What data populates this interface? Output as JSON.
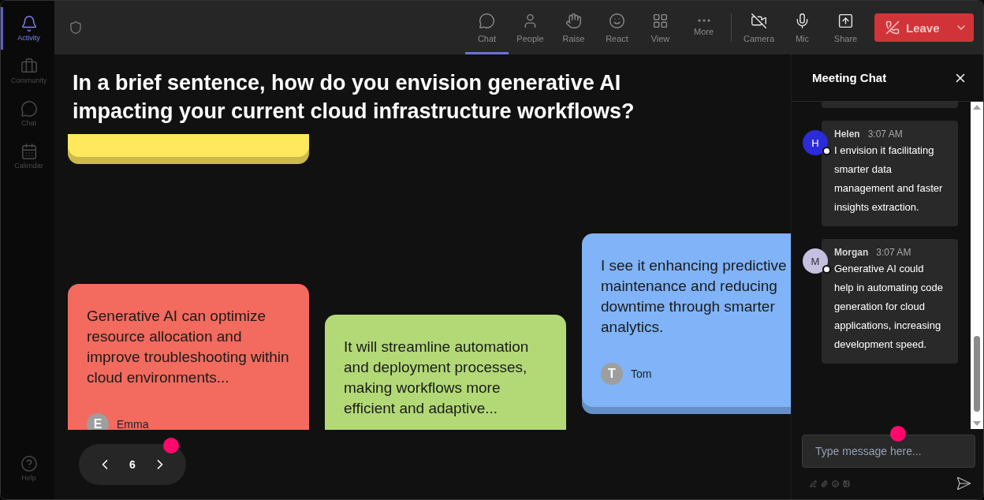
{
  "sidebar": {
    "items": [
      {
        "label": "Activity",
        "selected": true
      },
      {
        "label": "Community",
        "selected": false
      },
      {
        "label": "Chat",
        "selected": false
      },
      {
        "label": "Calendar",
        "selected": false
      }
    ],
    "footer_item": {
      "label": "Help"
    }
  },
  "toolbar": {
    "items": [
      {
        "label": "Chat",
        "selected": true
      },
      {
        "label": "People",
        "selected": false
      },
      {
        "label": "Raise",
        "selected": false
      },
      {
        "label": "React",
        "selected": false
      },
      {
        "label": "View",
        "selected": false
      },
      {
        "label": "More",
        "selected": false
      }
    ],
    "devices": [
      {
        "label": "Camera"
      },
      {
        "label": "Mic"
      },
      {
        "label": "Share"
      }
    ],
    "leave_button": "Leave"
  },
  "question": "In a brief sentence, how do you envision generative AI impacting your current cloud infrastructure workflows?",
  "cards": [
    {
      "kind": "clipped",
      "color": "#ffe85c"
    },
    {
      "kind": "note",
      "color": "#f26b5e",
      "text": "Generative AI can optimize resource allocation and improve troubleshooting within cloud environments...",
      "author": "Emma",
      "initial": "E"
    },
    {
      "kind": "note",
      "color": "#b3d977",
      "text": "It will streamline automation and deployment processes, making workflows more efficient and adaptive..."
    },
    {
      "kind": "note",
      "color": "#80b3f7",
      "text": "I see it enhancing predictive maintenance and reducing downtime through smarter analytics.",
      "author": "Tom",
      "initial": "T"
    }
  ],
  "pager": {
    "page": "6"
  },
  "chat": {
    "title": "Meeting Chat",
    "messages": [
      {
        "kind": "clipped"
      },
      {
        "kind": "message",
        "author": "Helen",
        "initial": "H",
        "color": "#2b2bd9",
        "time": "3:07 AM",
        "text": "I envision it facilitating smarter data management and faster insights extraction."
      },
      {
        "kind": "message",
        "author": "Morgan",
        "initial": "M",
        "color": "#c5c0e0",
        "time": "3:07 AM",
        "text": "Generative AI could help in automating code generation for cloud applications, increasing development speed."
      }
    ],
    "composer": {
      "placeholder": "Type message here..."
    }
  }
}
